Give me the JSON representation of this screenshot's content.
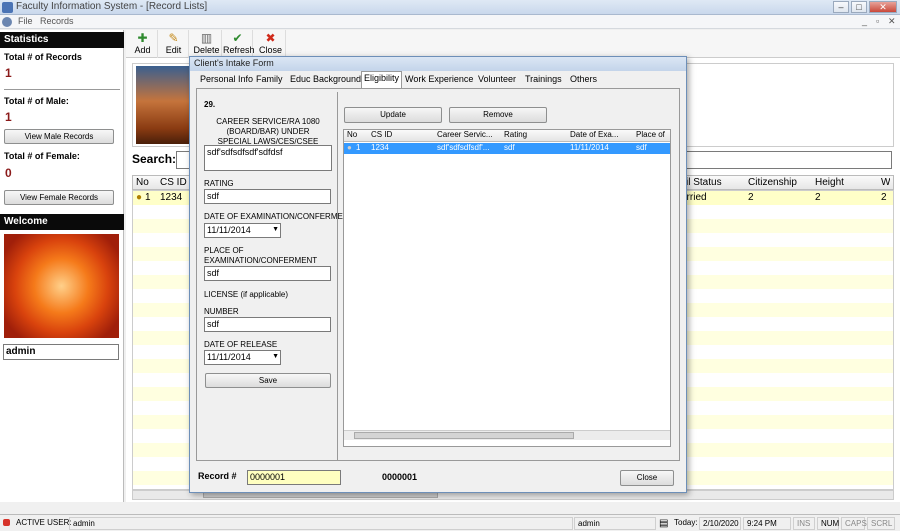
{
  "window": {
    "title": "Faculty Information System - [Record Lists]"
  },
  "menu": [
    "File",
    "Records"
  ],
  "toolbar": {
    "add": "Add",
    "edit": "Edit",
    "delete": "Delete",
    "refresh": "Refresh",
    "close": "Close"
  },
  "left_panel": {
    "statistics": "Statistics",
    "total_records_label": "Total # of Records",
    "total_records": "1",
    "total_male_label": "Total # of Male:",
    "total_male": "1",
    "view_male": "View Male Records",
    "total_female_label": "Total # of Female:",
    "total_female": "0",
    "view_female": "View Female Records",
    "welcome": "Welcome",
    "username": "admin"
  },
  "main": {
    "search_label": "Search:",
    "columns": [
      "No",
      "CS ID",
      "vil Status",
      "Citizenship",
      "Height",
      "W"
    ],
    "row": {
      "no": "1",
      "cs_id": "1234",
      "civil_status": "arried",
      "citizenship": "2",
      "height": "2",
      "weight": "2"
    }
  },
  "dialog": {
    "title": "Client's Intake Form",
    "tabs": [
      "Personal Info",
      "Family",
      "Educ Background",
      "Eligibility",
      "Work Experience",
      "Volunteer",
      "Trainings",
      "Others"
    ],
    "item_no": "29.",
    "career_label": "CAREER SERVICE/RA 1080 (BOARD/BAR) UNDER SPECIAL LAWS/CES/CSEE",
    "career_value": "sdf'sdfsdfsdf'sdfdsf",
    "rating_label": "RATING",
    "rating_value": "sdf",
    "doe_label": "DATE OF EXAMINATION/CONFERMENT",
    "doe_value": "11/11/2014",
    "place_label": "PLACE OF EXAMINATION/CONFERMENT",
    "place_value": "sdf",
    "license_label": "LICENSE (if applicable)",
    "number_label": "NUMBER",
    "number_value": "sdf",
    "dor_label": "DATE OF RELEASE",
    "dor_value": "11/11/2014",
    "save": "Save",
    "update": "Update",
    "remove": "Remove",
    "grid_columns": [
      "No",
      "CS ID",
      "Career Servic...",
      "Rating",
      "Date of Exa...",
      "Place of"
    ],
    "grid_row": {
      "no": "1",
      "cs_id": "1234",
      "career": "sdf'sdfsdfsdf'...",
      "rating": "sdf",
      "date": "11/11/2014",
      "place": "sdf"
    },
    "record_label": "Record #",
    "record_value": "0000001",
    "record_display": "0000001",
    "close": "Close"
  },
  "statusbar": {
    "active_user_label": "ACTIVE USER:",
    "active_user": "admin",
    "user2": "admin",
    "today_label": "Today:",
    "date": "2/10/2020",
    "time": "9:24 PM",
    "ins": "INS",
    "num": "NUM",
    "caps": "CAPS",
    "scrl": "SCRL"
  }
}
